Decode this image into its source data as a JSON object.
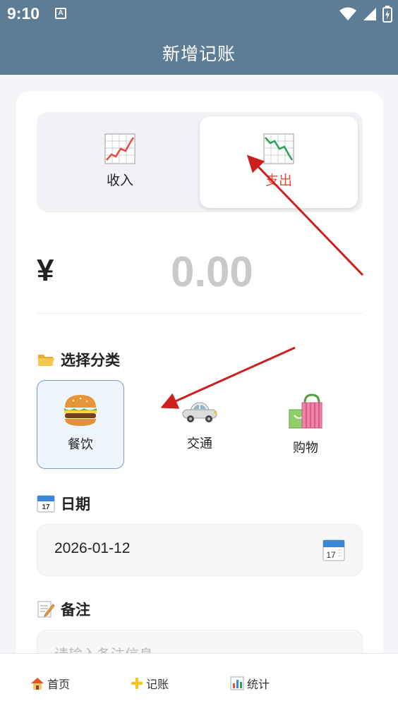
{
  "status_bar": {
    "time": "9:10",
    "notification": "A"
  },
  "app_bar": {
    "title": "新增记账"
  },
  "type_toggle": {
    "income_label": "收入",
    "expense_label": "支出",
    "selected": "expense",
    "selected_color": "#e74c3c"
  },
  "amount": {
    "currency": "¥",
    "value": "0.00"
  },
  "category_section": {
    "title": "选择分类",
    "icon": "folder-icon",
    "items": [
      {
        "label": "餐饮",
        "icon": "hamburger-icon",
        "selected": true
      },
      {
        "label": "交通",
        "icon": "car-icon",
        "selected": false
      },
      {
        "label": "购物",
        "icon": "shopping-bag-icon",
        "selected": false
      }
    ]
  },
  "date_section": {
    "title": "日期",
    "icon": "calendar-icon",
    "value": "2026-01-12"
  },
  "note_section": {
    "title": "备注",
    "icon": "memo-icon",
    "placeholder": "请输入备注信息"
  },
  "tab_bar": [
    {
      "label": "首页",
      "icon": "house-icon"
    },
    {
      "label": "记账",
      "icon": "plus-icon"
    },
    {
      "label": "统计",
      "icon": "bar-chart-icon"
    }
  ],
  "colors": {
    "primary": "#5d7d97",
    "accent_red": "#e74c3c",
    "annotation_arrow": "#cc1f1f"
  }
}
